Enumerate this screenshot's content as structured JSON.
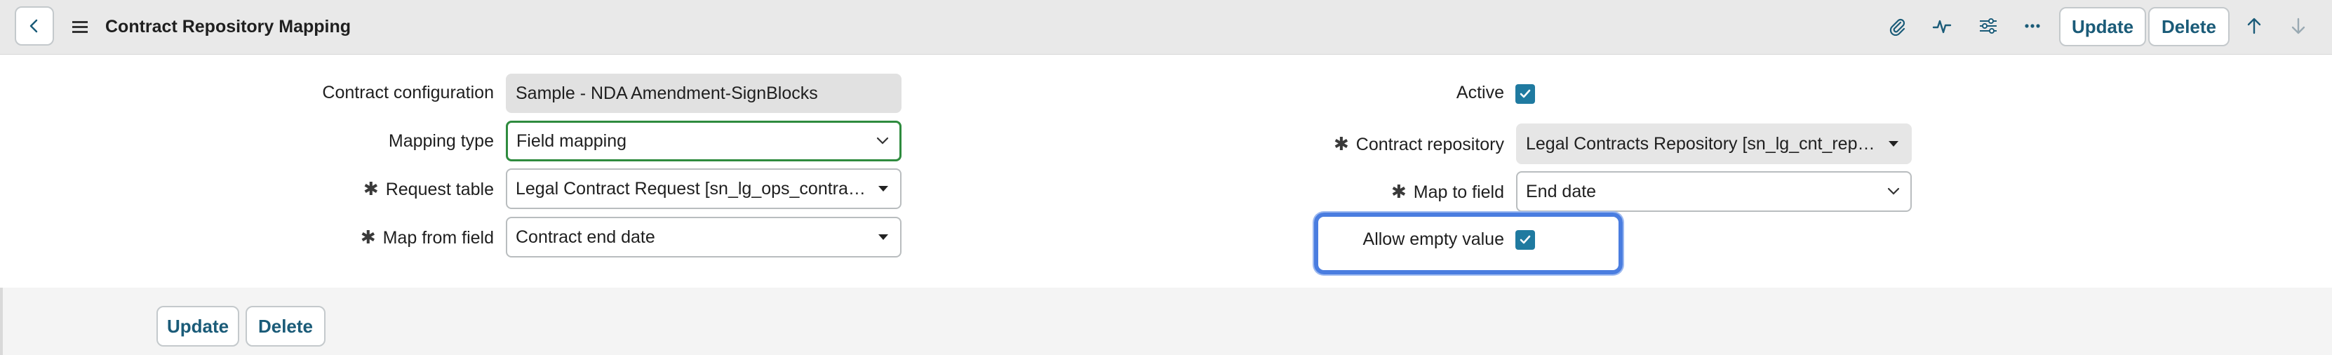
{
  "header": {
    "title": "Contract Repository Mapping",
    "update_label": "Update",
    "delete_label": "Delete",
    "icons": [
      "back-icon",
      "menu-icon",
      "paperclip-icon",
      "activity-icon",
      "settings-sliders-icon",
      "more-icon",
      "arrow-up-icon",
      "arrow-down-icon"
    ]
  },
  "form": {
    "contract_configuration": {
      "label": "Contract configuration",
      "value": "Sample - NDA Amendment-SignBlocks"
    },
    "mapping_type": {
      "label": "Mapping type",
      "value": "Field mapping"
    },
    "request_table": {
      "label": "Request table",
      "value": "Legal Contract Request [sn_lg_ops_contract..."
    },
    "map_from_field": {
      "label": "Map from field",
      "value": "Contract end date"
    },
    "active": {
      "label": "Active",
      "checked": true
    },
    "contract_repository": {
      "label": "Contract repository",
      "value": "Legal Contracts Repository [sn_lg_cnt_repo..."
    },
    "map_to_field": {
      "label": "Map to field",
      "value": "End date"
    },
    "allow_empty_value": {
      "label": "Allow empty value",
      "checked": true
    },
    "required_marker": "✱"
  },
  "footer": {
    "update_label": "Update",
    "delete_label": "Delete"
  },
  "colors": {
    "accent": "#1f7aa0",
    "button_text": "#1a5b78",
    "focus": "#2e8b3e",
    "highlight": "#4a7de0"
  }
}
